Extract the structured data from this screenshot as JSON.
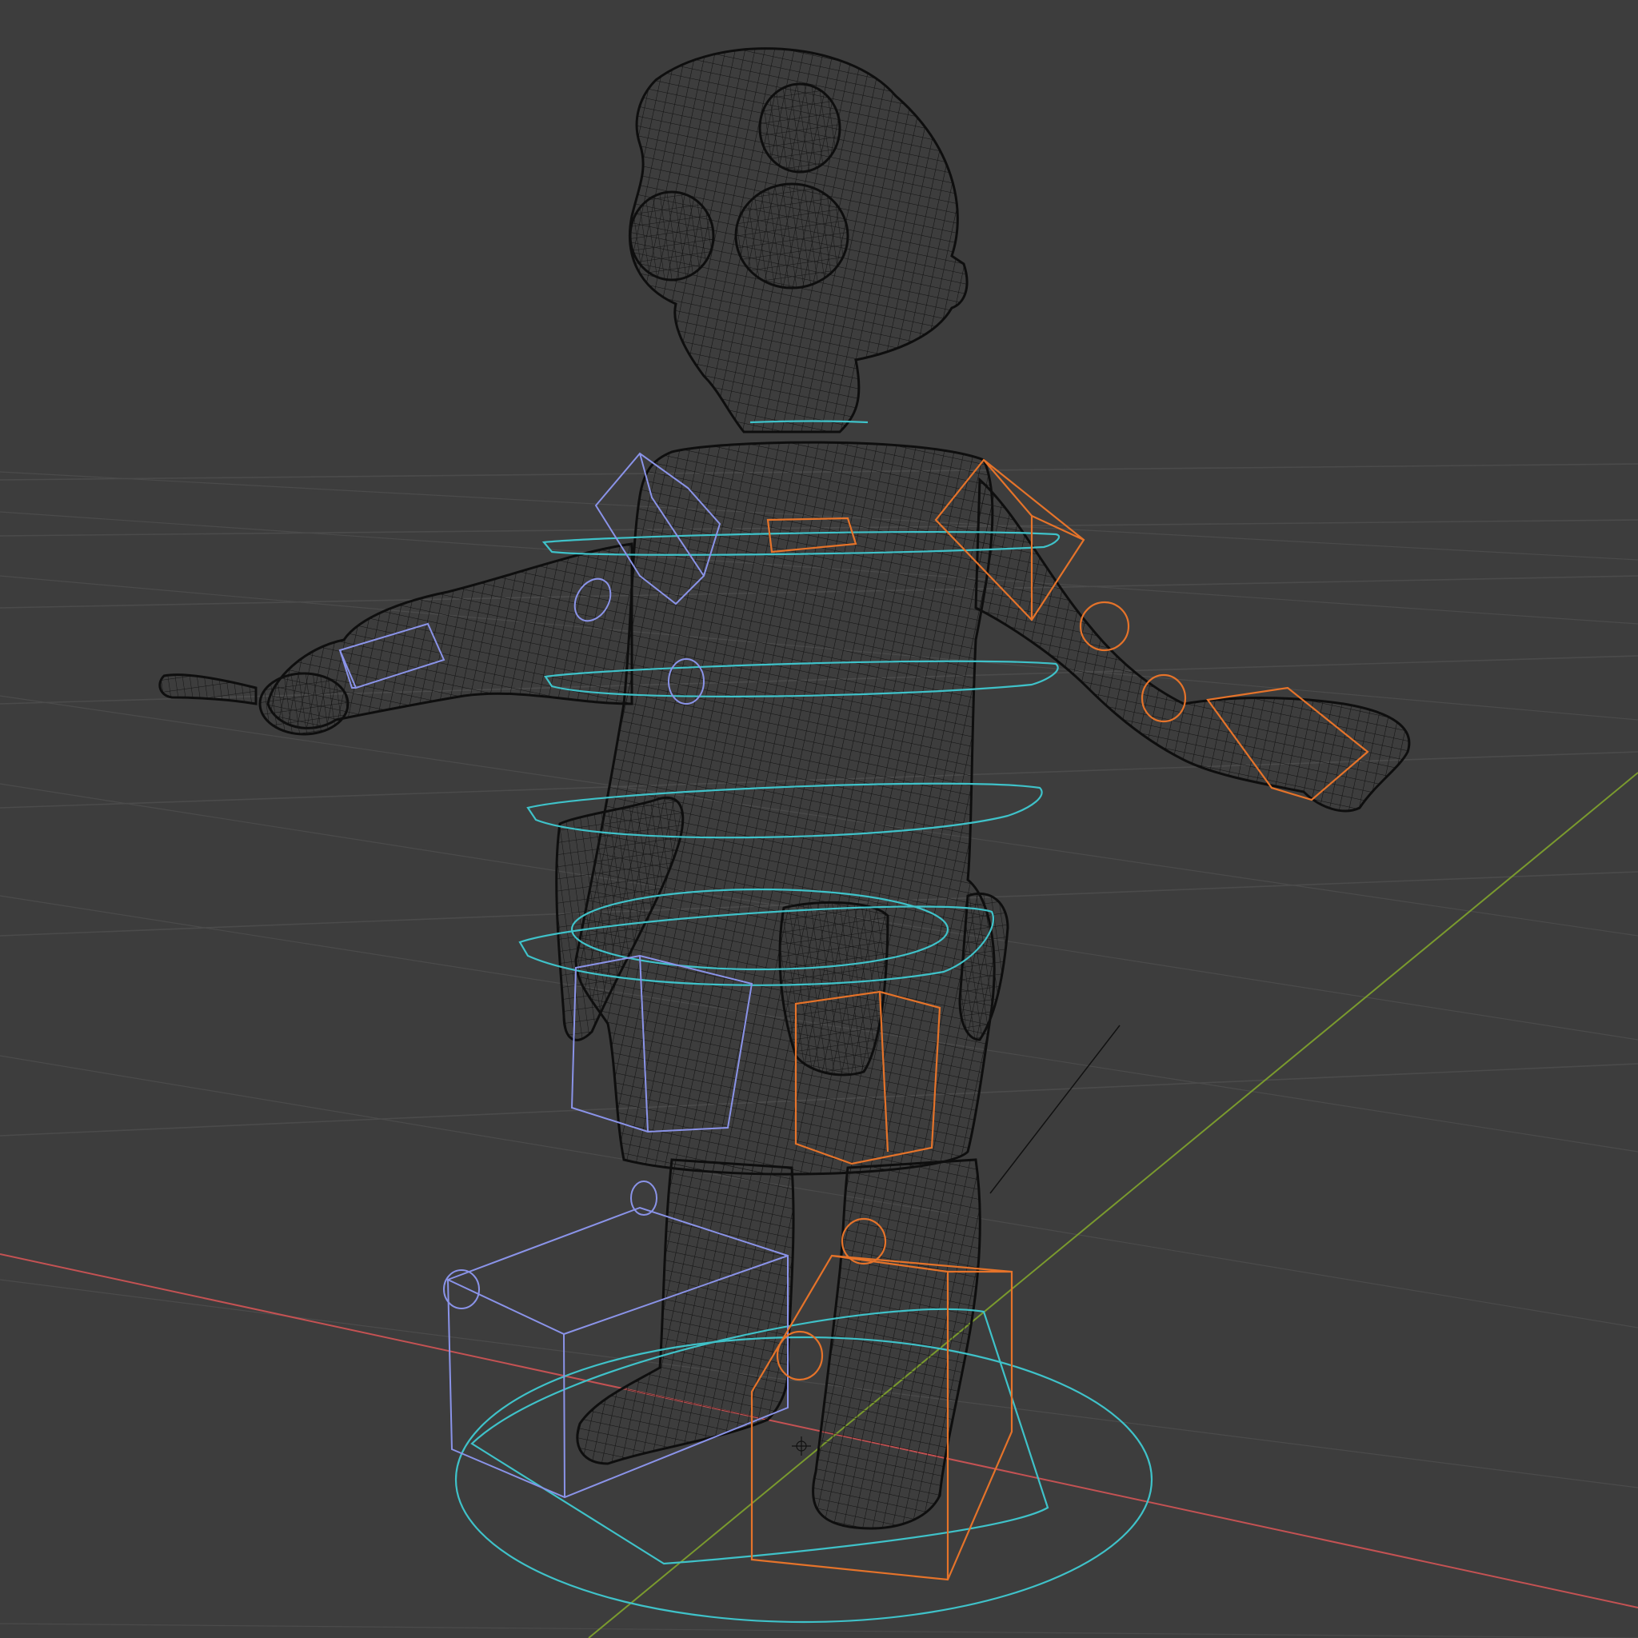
{
  "viewport": {
    "mode": "wireframe",
    "background_color": "#3d3d3d"
  },
  "colors": {
    "grid": "#4b4b4b",
    "axis_x": "#c45253",
    "axis_y": "#7a9a2e",
    "mesh_wire": "#101010",
    "control_cyan": "#3fc2c9",
    "control_left": "#8a93e8",
    "control_right": "#e5732a"
  },
  "legend": {
    "icon_names": [
      "wireframe-mesh",
      "cyan-torso-control",
      "blue-left-control",
      "orange-right-control",
      "world-origin"
    ]
  }
}
